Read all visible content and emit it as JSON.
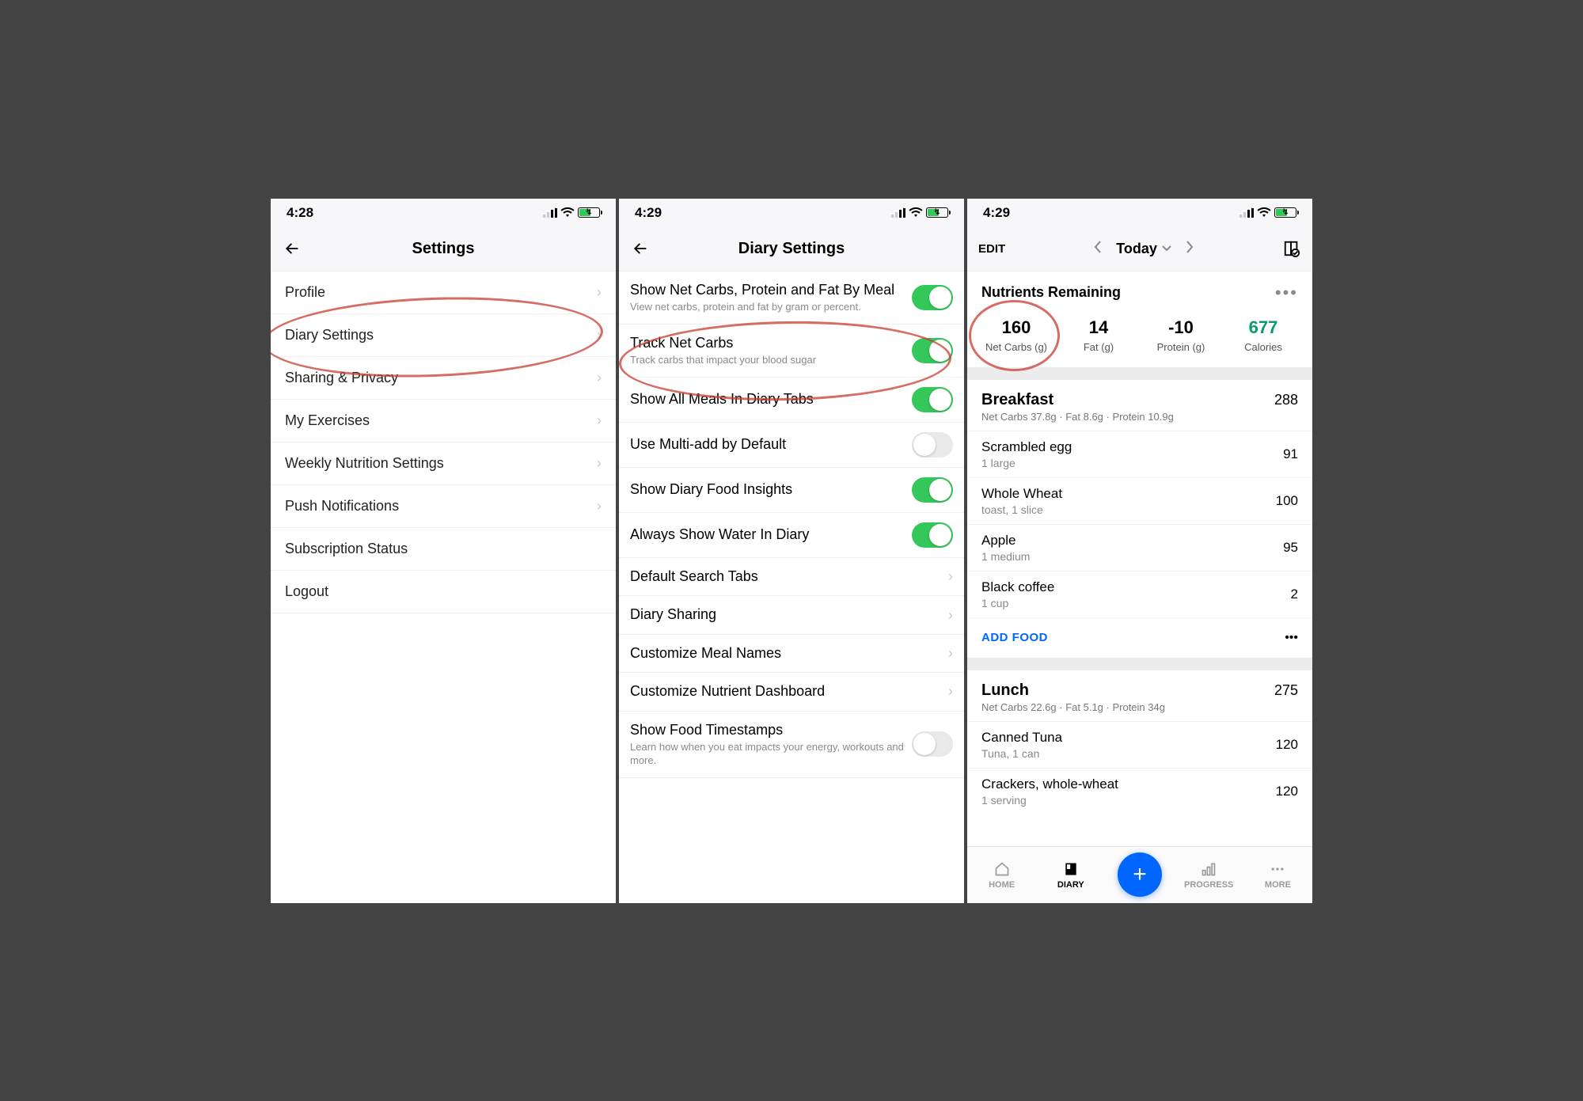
{
  "screen1": {
    "time": "4:28",
    "title": "Settings",
    "items": [
      "Profile",
      "Diary Settings",
      "Sharing & Privacy",
      "My Exercises",
      "Weekly Nutrition Settings",
      "Push Notifications",
      "Subscription Status",
      "Logout"
    ],
    "chevrons": [
      true,
      true,
      true,
      true,
      true,
      true,
      false,
      false
    ]
  },
  "screen2": {
    "time": "4:29",
    "title": "Diary Settings",
    "rows": [
      {
        "title": "Show Net Carbs, Protein and Fat By Meal",
        "sub": "View net carbs, protein and fat by gram or percent.",
        "type": "toggle",
        "on": true
      },
      {
        "title": "Track Net Carbs",
        "sub": "Track carbs that impact your blood sugar",
        "type": "toggle",
        "on": true
      },
      {
        "title": "Show All Meals In Diary Tabs",
        "sub": "",
        "type": "toggle",
        "on": true
      },
      {
        "title": "Use Multi-add by Default",
        "sub": "",
        "type": "toggle",
        "on": false
      },
      {
        "title": "Show Diary Food Insights",
        "sub": "",
        "type": "toggle",
        "on": true
      },
      {
        "title": "Always Show Water In Diary",
        "sub": "",
        "type": "toggle",
        "on": true
      },
      {
        "title": "Default Search Tabs",
        "sub": "",
        "type": "link"
      },
      {
        "title": "Diary Sharing",
        "sub": "",
        "type": "link"
      },
      {
        "title": "Customize Meal Names",
        "sub": "",
        "type": "link"
      },
      {
        "title": "Customize Nutrient Dashboard",
        "sub": "",
        "type": "link"
      },
      {
        "title": "Show Food Timestamps",
        "sub": "Learn how when you eat impacts your energy, workouts and more.",
        "type": "toggle",
        "on": false
      }
    ]
  },
  "screen3": {
    "time": "4:29",
    "edit": "EDIT",
    "dateLabel": "Today",
    "nutriTitle": "Nutrients Remaining",
    "nutrients": [
      {
        "value": "160",
        "label": "Net Carbs (g)",
        "green": false
      },
      {
        "value": "14",
        "label": "Fat (g)",
        "green": false
      },
      {
        "value": "-10",
        "label": "Protein (g)",
        "green": false
      },
      {
        "value": "677",
        "label": "Calories",
        "green": true
      }
    ],
    "meals": [
      {
        "name": "Breakfast",
        "cal": "288",
        "macros": "Net Carbs 37.8g · Fat 8.6g · Protein 10.9g",
        "foods": [
          {
            "name": "Scrambled egg",
            "detail": "1 large",
            "cal": "91"
          },
          {
            "name": "Whole Wheat",
            "detail": "toast, 1 slice",
            "cal": "100"
          },
          {
            "name": "Apple",
            "detail": "1 medium",
            "cal": "95"
          },
          {
            "name": "Black coffee",
            "detail": "1 cup",
            "cal": "2"
          }
        ],
        "addFood": "ADD FOOD"
      },
      {
        "name": "Lunch",
        "cal": "275",
        "macros": "Net Carbs 22.6g · Fat 5.1g · Protein 34g",
        "foods": [
          {
            "name": "Canned Tuna",
            "detail": "Tuna, 1 can",
            "cal": "120"
          },
          {
            "name": "Crackers, whole-wheat",
            "detail": "1 serving",
            "cal": "120"
          }
        ]
      }
    ],
    "tabs": [
      "HOME",
      "DIARY",
      "",
      "PROGRESS",
      "MORE"
    ]
  }
}
